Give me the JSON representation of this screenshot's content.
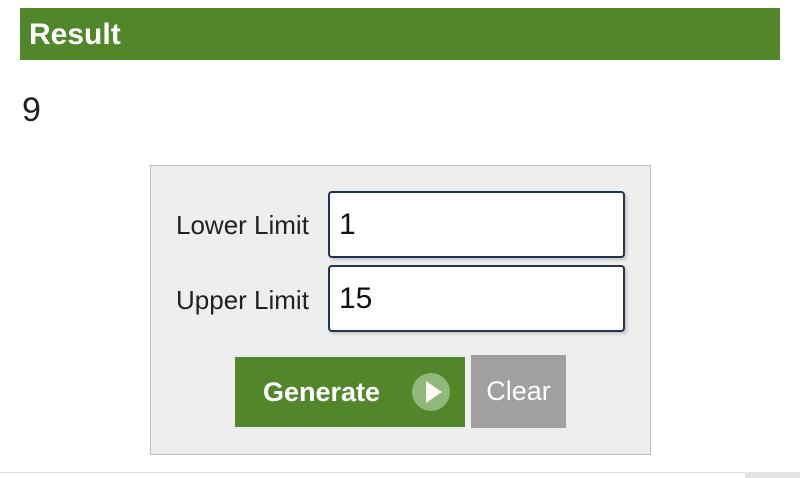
{
  "result": {
    "title": "Result",
    "value": "9"
  },
  "form": {
    "lower_limit_label": "Lower Limit",
    "lower_limit_value": "1",
    "upper_limit_label": "Upper Limit",
    "upper_limit_value": "15",
    "generate_label": "Generate",
    "clear_label": "Clear"
  },
  "icons": {
    "generate": "play-icon"
  },
  "colors": {
    "brand_green": "#51862a",
    "panel_bg": "#eeeeee",
    "clear_gray": "#a0a0a0",
    "input_border": "#1f3550"
  }
}
